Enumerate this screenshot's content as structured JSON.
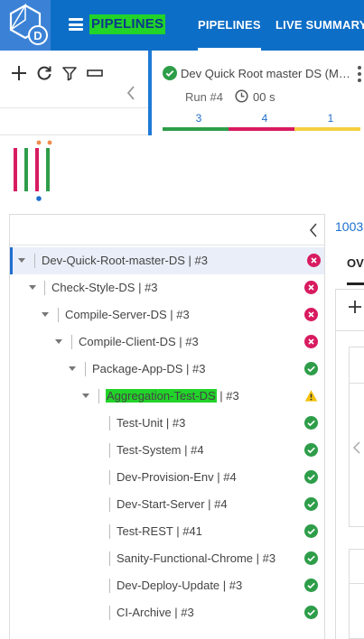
{
  "header": {
    "brand": "PIPELINES",
    "tabs": [
      {
        "label": "PIPELINES",
        "active": true
      },
      {
        "label": "LIVE SUMMARY",
        "active": false
      }
    ],
    "logo_letter": "D"
  },
  "toolbar": {
    "icons": [
      "plus-icon",
      "refresh-icon",
      "filter-icon",
      "collapse-all-icon"
    ]
  },
  "run_card": {
    "title": "Dev Quick Root master DS (Mo...",
    "run": "Run #4",
    "duration": "00 s",
    "counts": [
      {
        "value": "3",
        "color": "#2e9d49"
      },
      {
        "value": "4",
        "color": "#d81b60"
      },
      {
        "value": "1",
        "color": "#f4d03f"
      }
    ]
  },
  "loader_colors": [
    "#d81b60",
    "#2e9d49",
    "#d81b60",
    "#2e9d49"
  ],
  "tree": {
    "rows": [
      {
        "label": "Dev-Quick-Root-master-DS | #3",
        "status": "failed",
        "selected": true,
        "highlight": ""
      },
      {
        "label": "Check-Style-DS | #3",
        "status": "failed",
        "selected": false,
        "highlight": ""
      },
      {
        "label": "Compile-Server-DS | #3",
        "status": "failed",
        "selected": false,
        "highlight": ""
      },
      {
        "label": "Compile-Client-DS | #3",
        "status": "failed",
        "selected": false,
        "highlight": ""
      },
      {
        "label": "Package-App-DS | #3",
        "status": "success",
        "selected": false,
        "highlight": ""
      },
      {
        "label": " | #3",
        "status": "warning",
        "selected": false,
        "highlight": "Aggregation-Test-DS"
      },
      {
        "label": "Test-Unit | #3",
        "status": "success",
        "selected": false,
        "highlight": ""
      },
      {
        "label": "Test-System | #4",
        "status": "success",
        "selected": false,
        "highlight": ""
      },
      {
        "label": "Dev-Provision-Env | #4",
        "status": "success",
        "selected": false,
        "highlight": ""
      },
      {
        "label": "Dev-Start-Server | #4",
        "status": "success",
        "selected": false,
        "highlight": ""
      },
      {
        "label": "Test-REST | #41",
        "status": "success",
        "selected": false,
        "highlight": ""
      },
      {
        "label": "Sanity-Functional-Chrome | #3",
        "status": "success",
        "selected": false,
        "highlight": ""
      },
      {
        "label": "Dev-Deploy-Update | #3",
        "status": "success",
        "selected": false,
        "highlight": ""
      },
      {
        "label": "CI-Archive | #3",
        "status": "success",
        "selected": false,
        "highlight": ""
      }
    ]
  },
  "right": {
    "link": "1003",
    "tab": "OV"
  },
  "colors": {
    "header": "#0d6ec7",
    "accent": "#1f6fd0",
    "success": "#2e9d49",
    "failed": "#d81b60",
    "warning": "#f4d03f",
    "highlight": "#22d32a"
  }
}
